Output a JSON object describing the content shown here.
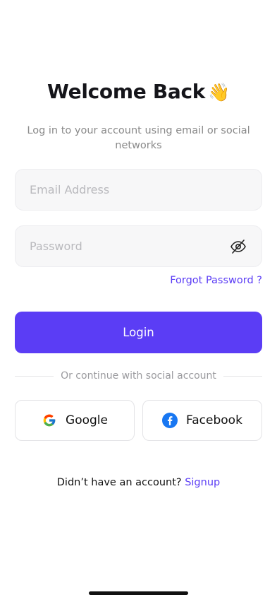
{
  "header": {
    "title": "Welcome Back",
    "title_emoji": "👋",
    "subtitle": "Log in to your account using email or social networks"
  },
  "form": {
    "email_placeholder": "Email Address",
    "email_value": "",
    "password_placeholder": "Password",
    "password_value": "",
    "password_toggle_icon": "eye-off-icon",
    "forgot_label": "Forgot Password ?",
    "login_label": "Login"
  },
  "social": {
    "divider_text": "Or continue with social account",
    "google_label": "Google",
    "google_icon": "google-icon",
    "facebook_label": "Facebook",
    "facebook_icon": "facebook-icon"
  },
  "footer": {
    "prompt": "Didn’t have an account?",
    "signup_label": "Signup"
  },
  "colors": {
    "accent": "#5b3df5",
    "field_bg": "#f7f7f8",
    "facebook": "#1877f2"
  }
}
